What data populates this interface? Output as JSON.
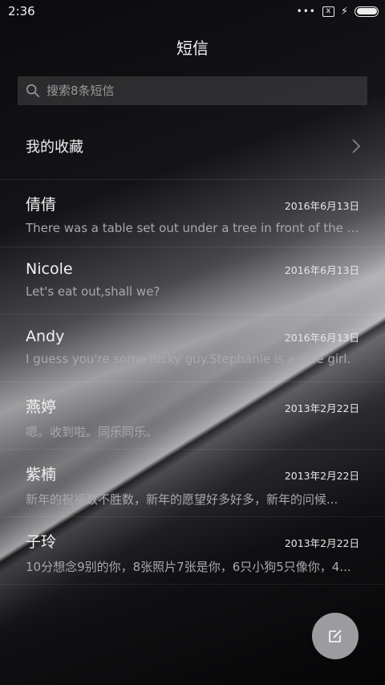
{
  "status_bar": {
    "time": "2:36",
    "dots": "•••",
    "sim_icon": "x",
    "icons": [
      "signal-dots-icon",
      "sim-x-icon",
      "charging-bolt-icon",
      "battery-icon"
    ]
  },
  "header": {
    "title": "短信"
  },
  "search": {
    "placeholder": "搜索8条短信"
  },
  "favorites": {
    "label": "我的收藏"
  },
  "conversations": [
    {
      "name": "倩倩",
      "date": "2016年6月13日",
      "snippet": "There was a table set out under a tree in front of the ho..."
    },
    {
      "name": "Nicole",
      "date": "2016年6月13日",
      "snippet": "Let's eat out,shall we?"
    },
    {
      "name": "Andy",
      "date": "2016年6月13日",
      "snippet": "I guess you're some lucky guy.Stephanie is a nice girl."
    },
    {
      "name": "燕婷",
      "date": "2013年2月22日",
      "snippet": "嗯。收到啦。同乐同乐。"
    },
    {
      "name": "紫楠",
      "date": "2013年2月22日",
      "snippet": "新年的祝福数不胜数，新年的愿望好多好多，新年的问候..."
    },
    {
      "name": "子玲",
      "date": "2013年2月22日",
      "snippet": "10分想念9别的你，8张照片7张是你，6只小狗5只像你，4..."
    }
  ],
  "fab": {
    "icon": "compose-icon"
  },
  "colors": {
    "fab": "#9c9c9f",
    "search_bg": "#2a2a2d",
    "text_secondary": "#a9a9ad"
  }
}
